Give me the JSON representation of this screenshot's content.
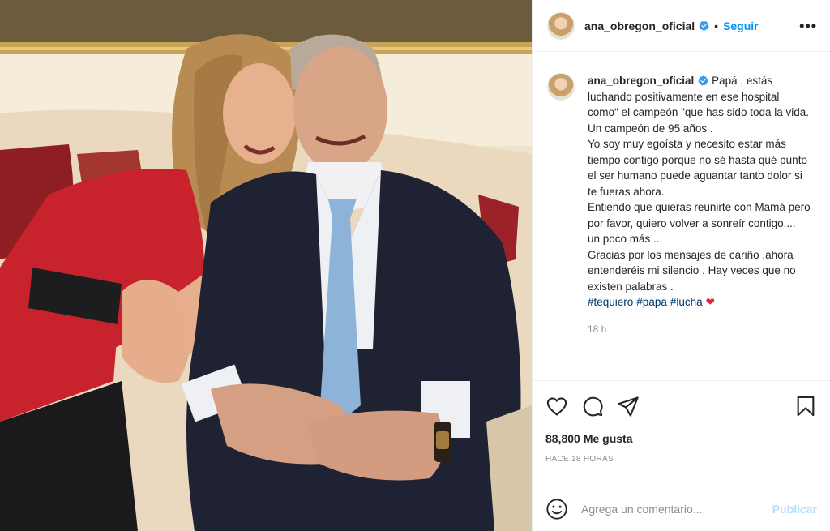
{
  "header": {
    "username": "ana_obregon_oficial",
    "separator": "•",
    "follow_label": "Seguir",
    "more_label": "•••"
  },
  "caption": {
    "username": "ana_obregon_oficial",
    "lines": [
      "Papá , estás luchando positivamente en ese hospital como\" el campeón \"que has sido toda la vida.",
      "Un campeón de 95 años .",
      "Yo soy muy egoísta y necesito estar más tiempo contigo porque no sé hasta qué punto el ser humano puede aguantar tanto dolor si te fueras ahora.",
      "Entiendo que quieras reunirte con Mamá pero por favor, quiero volver a sonreír contigo.... un poco más ...",
      "Gracias por los mensajes de cariño ,ahora entenderéis mi silencio . Hay veces que no existen palabras ."
    ],
    "hashtags": [
      "#tequiero",
      "#papa",
      "#lucha"
    ],
    "heart": "❤",
    "time": "18 h"
  },
  "actions": {
    "icons": [
      "heart-icon",
      "comment-icon",
      "share-icon",
      "bookmark-icon"
    ]
  },
  "likes": {
    "count": "88,800",
    "label": "Me gusta"
  },
  "posted_ago": "HACE 18 HORAS",
  "comment_box": {
    "placeholder": "Agrega un comentario...",
    "publish_label": "Publicar"
  },
  "colors": {
    "accent": "#0095f6",
    "publish_disabled": "#b2dffc",
    "hashtag": "#00376b",
    "verified": "#3897f0",
    "secondary_text": "#8e8e8e"
  }
}
